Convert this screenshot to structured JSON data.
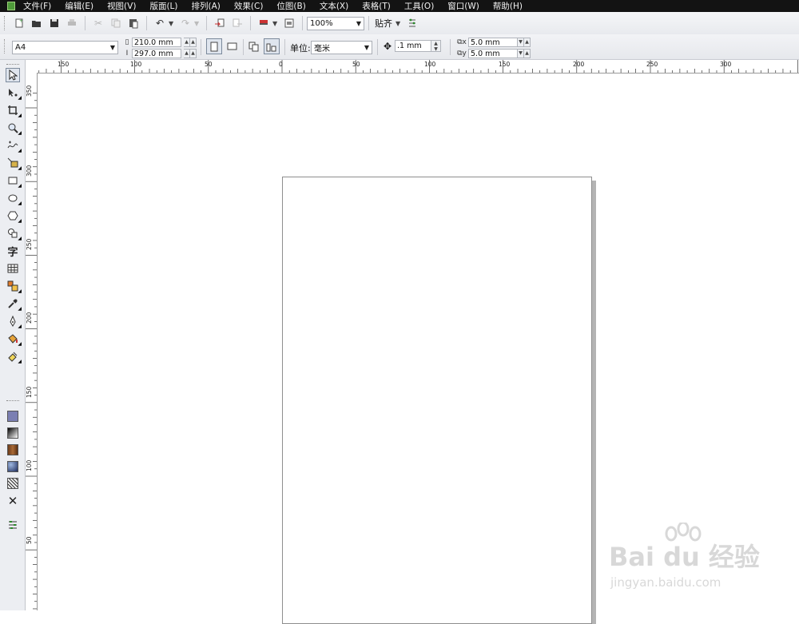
{
  "menu": {
    "items": [
      "文件(F)",
      "编辑(E)",
      "视图(V)",
      "版面(L)",
      "排列(A)",
      "效果(C)",
      "位图(B)",
      "文本(X)",
      "表格(T)",
      "工具(O)",
      "窗口(W)",
      "帮助(H)"
    ]
  },
  "toolbar": {
    "zoom_value": "100%",
    "snap_label": "贴齐"
  },
  "property_bar": {
    "page_size": "A4",
    "width": "210.0 mm",
    "height": "297.0 mm",
    "unit_label": "单位:",
    "unit_value": "毫米",
    "nudge": ".1 mm",
    "dup_x": "5.0 mm",
    "dup_y": "5.0 mm"
  },
  "ruler": {
    "top_labels": [
      "150",
      "100",
      "50",
      "0",
      "50",
      "100",
      "150",
      "200",
      "250",
      "300"
    ],
    "left_labels": [
      "350",
      "300",
      "250",
      "200",
      "150",
      "100",
      "50"
    ]
  },
  "watermark": {
    "logo": "Bai du 经验",
    "url": "jingyan.baidu.com"
  },
  "colors": {
    "menubar_bg": "#131313",
    "fill_swatch": "#7b7fb2",
    "page_border": "#8e8e8e",
    "page_shadow": "#b4b4b4"
  },
  "icons": {
    "standard": [
      "new-icon",
      "open-icon",
      "save-icon",
      "print-icon",
      "cut-icon",
      "copy-icon",
      "paste-icon",
      "undo-icon",
      "redo-icon",
      "import-icon",
      "export-icon",
      "app-launcher-icon",
      "welcome-screen-icon",
      "options-icon"
    ],
    "tools": [
      "pick-tool-icon",
      "shape-tool-icon",
      "crop-tool-icon",
      "zoom-tool-icon",
      "freehand-tool-icon",
      "smart-fill-icon",
      "rectangle-tool-icon",
      "ellipse-tool-icon",
      "polygon-tool-icon",
      "basic-shapes-icon",
      "text-tool-icon",
      "table-tool-icon",
      "blend-tool-icon",
      "eyedropper-tool-icon",
      "outline-pen-icon",
      "fill-tool-icon",
      "interactive-fill-icon"
    ]
  }
}
